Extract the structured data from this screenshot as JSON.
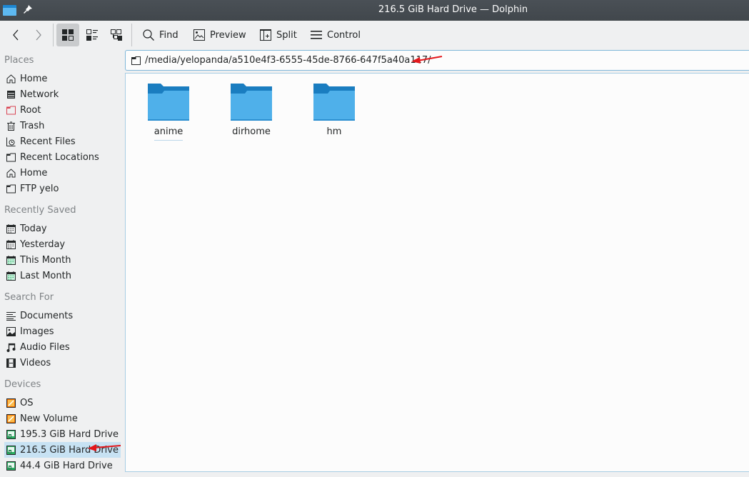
{
  "window": {
    "title": "216.5 GiB Hard Drive — Dolphin",
    "accent": "#3daee9"
  },
  "toolbar": {
    "back_icon": "chevron-left-icon",
    "forward_icon": "chevron-right-icon",
    "view_modes": [
      "icons",
      "compact",
      "details"
    ],
    "active_view_mode": "icons",
    "find_label": "Find",
    "preview_label": "Preview",
    "split_label": "Split",
    "control_label": "Control"
  },
  "location": {
    "path": "/media/yelopanda/a510e4f3-6555-45de-8766-647f5a40a117/"
  },
  "sidebar": {
    "sections": [
      {
        "label": "Places",
        "items": [
          {
            "label": "Home",
            "icon": "home-icon"
          },
          {
            "label": "Network",
            "icon": "network-icon"
          },
          {
            "label": "Root",
            "icon": "root-folder-icon"
          },
          {
            "label": "Trash",
            "icon": "trash-icon"
          },
          {
            "label": "Recent Files",
            "icon": "recent-files-icon"
          },
          {
            "label": "Recent Locations",
            "icon": "folder-icon"
          },
          {
            "label": "Home",
            "icon": "home-icon"
          },
          {
            "label": "FTP yelo",
            "icon": "folder-icon"
          }
        ]
      },
      {
        "label": "Recently Saved",
        "items": [
          {
            "label": "Today",
            "icon": "calendar-icon"
          },
          {
            "label": "Yesterday",
            "icon": "calendar-icon"
          },
          {
            "label": "This Month",
            "icon": "calendar-green-icon"
          },
          {
            "label": "Last Month",
            "icon": "calendar-green-icon"
          }
        ]
      },
      {
        "label": "Search For",
        "items": [
          {
            "label": "Documents",
            "icon": "document-icon"
          },
          {
            "label": "Images",
            "icon": "image-icon"
          },
          {
            "label": "Audio Files",
            "icon": "audio-icon"
          },
          {
            "label": "Videos",
            "icon": "video-icon"
          }
        ]
      },
      {
        "label": "Devices",
        "items": [
          {
            "label": "OS",
            "icon": "drive-orange-icon"
          },
          {
            "label": "New Volume",
            "icon": "drive-orange-icon"
          },
          {
            "label": "195.3 GiB Hard Drive",
            "icon": "drive-green-icon"
          },
          {
            "label": "216.5 GiB Hard Drive",
            "icon": "drive-green-icon",
            "selected": true
          },
          {
            "label": "44.4 GiB Hard Drive",
            "icon": "drive-green-icon"
          }
        ]
      }
    ]
  },
  "files": [
    {
      "name": "anime",
      "type": "folder",
      "focused": true
    },
    {
      "name": "dirhome",
      "type": "folder"
    },
    {
      "name": "hm",
      "type": "folder"
    }
  ],
  "annotations": {
    "arrow_color": "#e3171b"
  }
}
